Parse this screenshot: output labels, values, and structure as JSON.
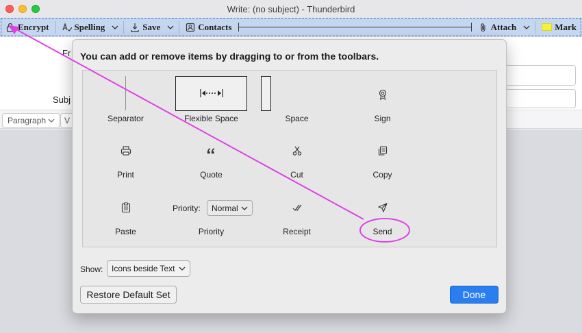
{
  "window": {
    "title": "Write: (no subject) - Thunderbird"
  },
  "toolbar": {
    "encrypt": "Encrypt",
    "spelling": "Spelling",
    "save": "Save",
    "contacts": "Contacts",
    "attach": "Attach",
    "mark": "Mark"
  },
  "compose": {
    "from_label_partial": "Fr",
    "subject_label_partial": "Subj",
    "paragraph_select": "Paragraph",
    "second_select_partial": "V"
  },
  "dialog": {
    "title": "You can add or remove items by dragging to or from the toolbars.",
    "items": {
      "separator": "Separator",
      "flexible_space": "Flexible Space",
      "space": "Space",
      "sign": "Sign",
      "print": "Print",
      "quote": "Quote",
      "cut": "Cut",
      "copy": "Copy",
      "paste": "Paste",
      "priority": "Priority",
      "receipt": "Receipt",
      "send": "Send"
    },
    "priority_label": "Priority:",
    "priority_value": "Normal",
    "show_label": "Show:",
    "show_value": "Icons beside Text",
    "restore_button": "Restore Default Set",
    "done_button": "Done"
  },
  "colors": {
    "toolbar_bg": "#c5d6ef",
    "toolbar_border": "#2d6fe0",
    "done_button": "#2a7ef0",
    "annotation": "#e040e8",
    "mark_swatch": "#f4f13a"
  },
  "icons": [
    "encrypt-icon",
    "spelling-icon",
    "save-icon",
    "contacts-icon",
    "attach-icon",
    "mark-icon",
    "sign-icon",
    "print-icon",
    "quote-icon",
    "cut-icon",
    "copy-icon",
    "paste-icon",
    "receipt-icon",
    "send-icon",
    "chevron-down-icon"
  ]
}
